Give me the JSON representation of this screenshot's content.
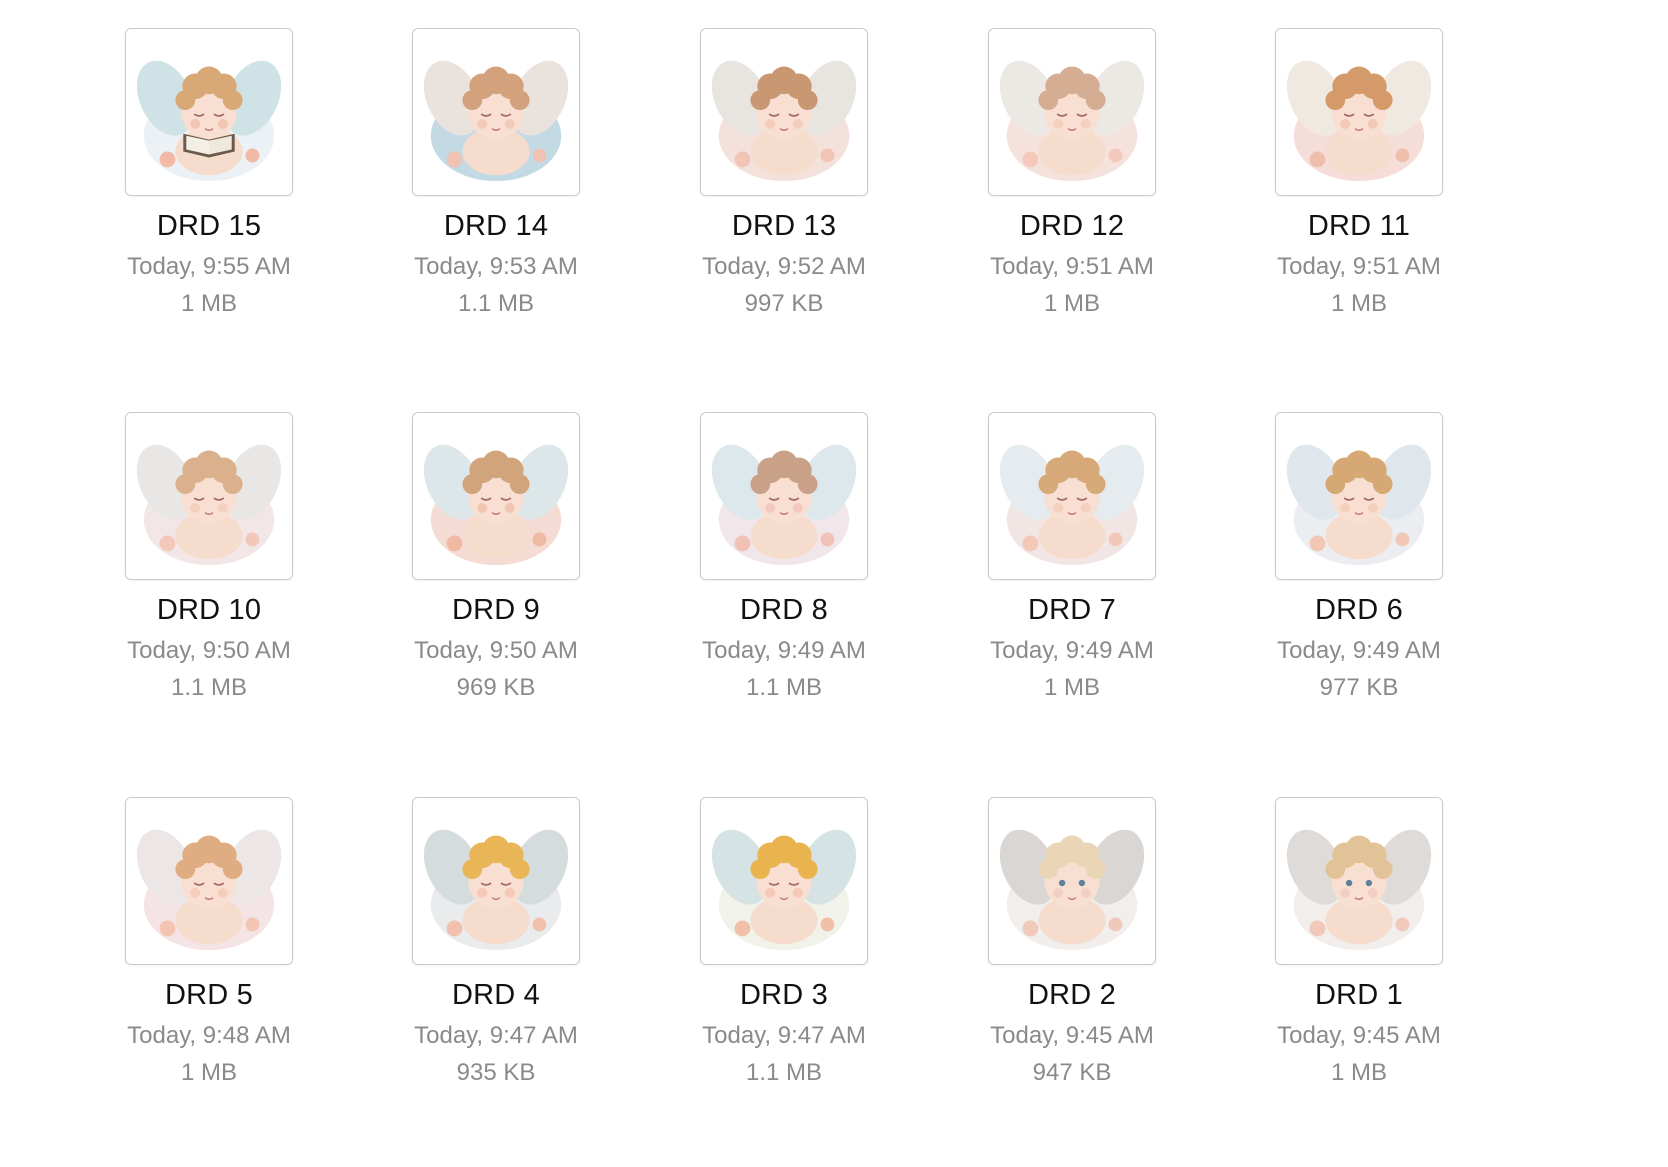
{
  "files": [
    {
      "name": "DRD 15",
      "date": "Today, 9:55 AM",
      "size": "1 MB",
      "thumbnail": "cherub-reading-book-icon",
      "palette": {
        "hair": "#d9a877",
        "cloud": "#e8eef3",
        "wing": "#cfe3e6",
        "accent": "#f1b9a6"
      }
    },
    {
      "name": "DRD 14",
      "date": "Today, 9:53 AM",
      "size": "1.1 MB",
      "thumbnail": "cherub-sleeping-blue-cloud-icon",
      "palette": {
        "hair": "#d3a27d",
        "cloud": "#b9d3e0",
        "wing": "#e9e2dd",
        "accent": "#f0c2b3"
      }
    },
    {
      "name": "DRD 13",
      "date": "Today, 9:52 AM",
      "size": "997 KB",
      "thumbnail": "cherub-sleeping-icon",
      "palette": {
        "hair": "#c99771",
        "cloud": "#f3dcd6",
        "wing": "#e8e4e0",
        "accent": "#f2c4b6"
      }
    },
    {
      "name": "DRD 12",
      "date": "Today, 9:51 AM",
      "size": "1 MB",
      "thumbnail": "cherub-sleeping-icon",
      "palette": {
        "hair": "#d4ad93",
        "cloud": "#f5ddd6",
        "wing": "#ece8e4",
        "accent": "#f3c9bb"
      }
    },
    {
      "name": "DRD 11",
      "date": "Today, 9:51 AM",
      "size": "1 MB",
      "thumbnail": "cherub-sleeping-icon",
      "palette": {
        "hair": "#d49a6a",
        "cloud": "#f3d7d3",
        "wing": "#efe9e2",
        "accent": "#efbfae"
      }
    },
    {
      "name": "DRD 10",
      "date": "Today, 9:50 AM",
      "size": "1.1 MB",
      "thumbnail": "cherub-sleeping-icon",
      "palette": {
        "hair": "#dbb08c",
        "cloud": "#f0e2e2",
        "wing": "#e9e7e6",
        "accent": "#f3c7b9"
      }
    },
    {
      "name": "DRD 9",
      "date": "Today, 9:50 AM",
      "size": "969 KB",
      "thumbnail": "cherub-sleeping-flowers-icon",
      "palette": {
        "hair": "#d2a47c",
        "cloud": "#f2d6cd",
        "wing": "#dde7ea",
        "accent": "#f0b9a4"
      }
    },
    {
      "name": "DRD 8",
      "date": "Today, 9:49 AM",
      "size": "1.1 MB",
      "thumbnail": "cherub-sleeping-icon",
      "palette": {
        "hair": "#c9a088",
        "cloud": "#efe3e6",
        "wing": "#dce8ec",
        "accent": "#f2c1b6"
      }
    },
    {
      "name": "DRD 7",
      "date": "Today, 9:49 AM",
      "size": "1 MB",
      "thumbnail": "cherub-sleeping-icon",
      "palette": {
        "hair": "#d7a978",
        "cloud": "#f0e2e1",
        "wing": "#e5ebee",
        "accent": "#f3c8b8"
      }
    },
    {
      "name": "DRD 6",
      "date": "Today, 9:49 AM",
      "size": "977 KB",
      "thumbnail": "cherub-sleeping-icon",
      "palette": {
        "hair": "#d6a873",
        "cloud": "#e8eaee",
        "wing": "#dfe7ec",
        "accent": "#f1c8b4"
      }
    },
    {
      "name": "DRD 5",
      "date": "Today, 9:48 AM",
      "size": "1 MB",
      "thumbnail": "cherub-sleeping-icon",
      "palette": {
        "hair": "#e0ad82",
        "cloud": "#f3dfe0",
        "wing": "#ece7e6",
        "accent": "#f4c4b3"
      }
    },
    {
      "name": "DRD 4",
      "date": "Today, 9:47 AM",
      "size": "935 KB",
      "thumbnail": "cherub-golden-curls-icon",
      "palette": {
        "hair": "#e8b656",
        "cloud": "#e6e8ea",
        "wing": "#d5dcde",
        "accent": "#f2c1ad"
      }
    },
    {
      "name": "DRD 3",
      "date": "Today, 9:47 AM",
      "size": "1.1 MB",
      "thumbnail": "cherub-golden-curls-icon",
      "palette": {
        "hair": "#e9b44e",
        "cloud": "#eef0e6",
        "wing": "#d6e3e4",
        "accent": "#f2bfa9"
      }
    },
    {
      "name": "DRD 2",
      "date": "Today, 9:45 AM",
      "size": "947 KB",
      "thumbnail": "cherub-awake-icon",
      "palette": {
        "hair": "#ead6b6",
        "cloud": "#efebe7",
        "wing": "#d9d6d3",
        "accent": "#f0c9bb"
      }
    },
    {
      "name": "DRD 1",
      "date": "Today, 9:45 AM",
      "size": "1 MB",
      "thumbnail": "cherub-awake-icon",
      "palette": {
        "hair": "#e2c398",
        "cloud": "#eeebe7",
        "wing": "#dedbd8",
        "accent": "#f1c8ba"
      }
    }
  ]
}
